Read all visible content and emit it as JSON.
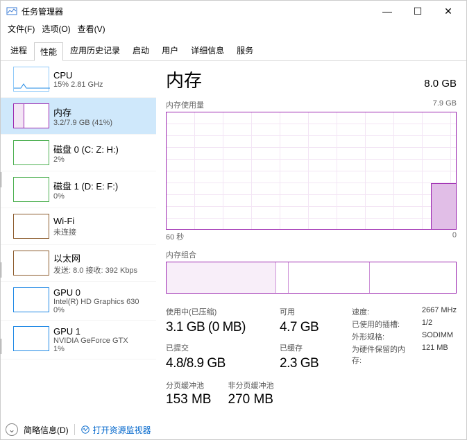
{
  "window": {
    "title": "任务管理器",
    "controls": {
      "minimize": "—",
      "maximize": "☐",
      "close": "✕"
    }
  },
  "menus": {
    "file": "文件(F)",
    "options": "选项(O)",
    "view": "查看(V)"
  },
  "tabs": {
    "processes": "进程",
    "performance": "性能",
    "history": "应用历史记录",
    "startup": "启动",
    "users": "用户",
    "details": "详细信息",
    "services": "服务"
  },
  "sidebar": {
    "items": [
      {
        "title": "CPU",
        "sub": "15%  2.81 GHz"
      },
      {
        "title": "内存",
        "sub": "3.2/7.9 GB (41%)"
      },
      {
        "title": "磁盘 0 (C: Z: H:)",
        "sub": "2%"
      },
      {
        "title": "磁盘 1 (D: E: F:)",
        "sub": "0%"
      },
      {
        "title": "Wi-Fi",
        "sub": "未连接"
      },
      {
        "title": "以太网",
        "sub": "发送: 8.0  接收: 392 Kbps"
      },
      {
        "title": "GPU 0",
        "sub": "Intel(R) HD Graphics 630",
        "sub2": "0%"
      },
      {
        "title": "GPU 1",
        "sub": "NVIDIA GeForce GTX",
        "sub2": "1%"
      }
    ]
  },
  "detail": {
    "title": "内存",
    "capacity": "8.0 GB",
    "chart_label": "内存使用量",
    "chart_max": "7.9 GB",
    "xaxis_left": "60 秒",
    "xaxis_right": "0",
    "comp_label": "内存组合",
    "stats": {
      "used_label": "使用中(已压缩)",
      "used_value": "3.1 GB (0 MB)",
      "avail_label": "可用",
      "avail_value": "4.7 GB",
      "commit_label": "已提交",
      "commit_value": "4.8/8.9 GB",
      "cached_label": "已缓存",
      "cached_value": "2.3 GB",
      "paged_label": "分页缓冲池",
      "paged_value": "153 MB",
      "nonpaged_label": "非分页缓冲池",
      "nonpaged_value": "270 MB"
    },
    "info": {
      "speed_k": "速度:",
      "speed_v": "2667 MHz",
      "slots_k": "已使用的插槽:",
      "slots_v": "1/2",
      "form_k": "外形规格:",
      "form_v": "SODIMM",
      "hw_k": "为硬件保留的内存:",
      "hw_v": "121 MB"
    }
  },
  "footer": {
    "brief": "简略信息(D)",
    "resmon": "打开资源监视器"
  },
  "chart_data": {
    "type": "area",
    "title": "内存使用量",
    "ylabel": "GB",
    "ylim": [
      0,
      7.9
    ],
    "xlabel": "秒",
    "xrange": [
      60,
      0
    ],
    "series": [
      {
        "name": "内存使用量",
        "x": [
          60,
          10,
          8,
          6,
          4,
          2,
          0
        ],
        "values": [
          0,
          0,
          0,
          3.1,
          3.1,
          3.1,
          3.1
        ]
      }
    ]
  }
}
